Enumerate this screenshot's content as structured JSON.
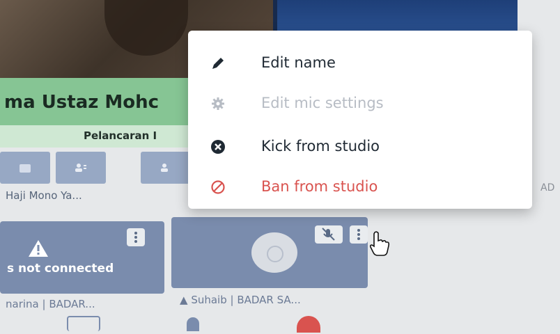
{
  "header": {
    "speaker_name": "ma Ustaz Mohc",
    "event_title": "Pelancaran I"
  },
  "participants_strip": {
    "label": "Haji Mono Ya..."
  },
  "tiles": [
    {
      "status": "s not connected",
      "label": "narina | BADAR..."
    },
    {
      "status": "",
      "label": "Suhaib | BADAR SA..."
    }
  ],
  "side_text": "AD",
  "menu": {
    "items": [
      {
        "label": "Edit name",
        "icon": "pencil-icon",
        "state": "enabled",
        "color": "#1f2933"
      },
      {
        "label": "Edit mic settings",
        "icon": "gear-icon",
        "state": "disabled",
        "color": "#b7bcc4"
      },
      {
        "label": "Kick from studio",
        "icon": "close-circle-icon",
        "state": "enabled",
        "color": "#1f2933"
      },
      {
        "label": "Ban from studio",
        "icon": "ban-icon",
        "state": "danger",
        "color": "#d9534f"
      }
    ]
  },
  "colors": {
    "banner_green": "#86c594",
    "tile_blue": "#7a8cad",
    "danger": "#d9534f"
  }
}
